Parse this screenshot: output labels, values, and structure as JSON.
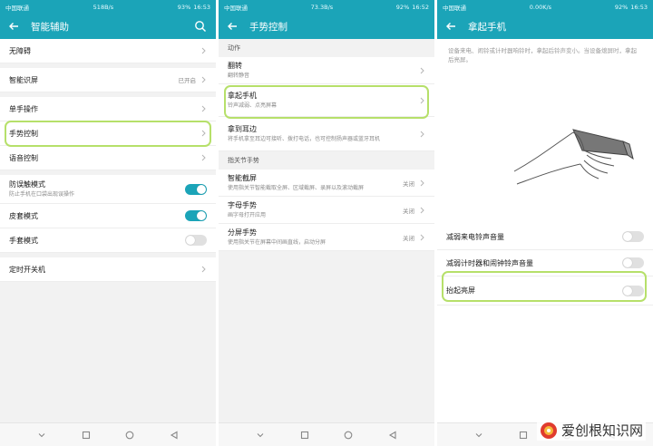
{
  "screens": [
    {
      "status": {
        "carrier": "中国联通",
        "speed": "518B/s",
        "battery": "93%",
        "time": "16:53"
      },
      "title": "智能辅助",
      "rows": [
        {
          "label": "无障碍"
        },
        {
          "label": "智能识屏",
          "value": "已开启"
        },
        {
          "label": "单手操作"
        },
        {
          "label": "手势控制"
        },
        {
          "label": "语音控制"
        },
        {
          "label": "防误触模式",
          "sub": "防止手机在口袋出现误操作",
          "toggle": "on"
        },
        {
          "label": "皮套模式",
          "toggle": "on"
        },
        {
          "label": "手套模式",
          "toggle": "off"
        },
        {
          "label": "定时开关机"
        }
      ]
    },
    {
      "status": {
        "carrier": "中国联通",
        "speed": "73.3B/s",
        "battery": "92%",
        "time": "16:52"
      },
      "title": "手势控制",
      "section1": "动作",
      "actions": [
        {
          "label": "翻转",
          "sub": "翻转静音"
        },
        {
          "label": "拿起手机",
          "sub": "铃声减弱、点亮屏幕"
        },
        {
          "label": "拿到耳边",
          "sub": "将手机拿至耳边可接听、拨打电话，也可控制扬声器或蓝牙耳机"
        }
      ],
      "section2": "指关节手势",
      "knuckle": [
        {
          "label": "智能截屏",
          "sub": "使用指关节智能截取全屏、区域截屏、录屏以及滚动截屏",
          "value": "关闭"
        },
        {
          "label": "字母手势",
          "sub": "画字母打开应用",
          "value": "关闭"
        },
        {
          "label": "分屏手势",
          "sub": "使用指关节在屏幕中间画直线，启动分屏",
          "value": "关闭"
        }
      ]
    },
    {
      "status": {
        "carrier": "中国联通",
        "speed": "0.00K/s",
        "battery": "92%",
        "time": "16:53"
      },
      "title": "拿起手机",
      "description": "设备来电、闹铃或计时器响铃时，拿起后铃声变小。当设备熄屏时，拿起后亮屏。",
      "rows": [
        {
          "label": "减弱来电铃声音量",
          "toggle": "off"
        },
        {
          "label": "减弱计时器和闹钟铃声音量",
          "toggle": "off"
        },
        {
          "label": "抬起亮屏",
          "toggle": "off"
        }
      ]
    }
  ],
  "watermark": {
    "text": "爱创根知识网"
  },
  "colors": {
    "accent": "#1ba4b8",
    "highlight": "#b6e06a",
    "background": "#f2f2f2"
  },
  "icons": [
    "back-arrow-icon",
    "search-icon",
    "chevron-right-icon",
    "nav-back-icon",
    "nav-home-icon",
    "nav-recent-icon",
    "notification-hide-icon",
    "signal-icon",
    "wifi-icon",
    "battery-icon"
  ]
}
